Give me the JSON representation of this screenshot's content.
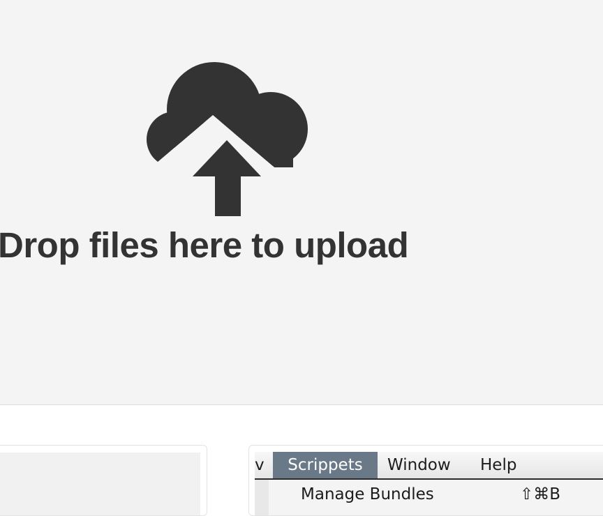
{
  "dropzone": {
    "icon": "cloud-upload-icon",
    "message": "Drop files here to upload",
    "colors": {
      "background": "#f4f4f4",
      "icon": "#333333",
      "text": "#333333"
    }
  },
  "menu_screenshot": {
    "menubar": {
      "partial_item": "v",
      "items": [
        {
          "label": "Scrippets",
          "active": true
        },
        {
          "label": "Window",
          "active": false
        },
        {
          "label": "Help",
          "active": false
        }
      ],
      "active_color": "#6a7987"
    },
    "dropdown": {
      "items": [
        {
          "label": "Manage Bundles",
          "shortcut": "⇧⌘B"
        }
      ]
    }
  }
}
